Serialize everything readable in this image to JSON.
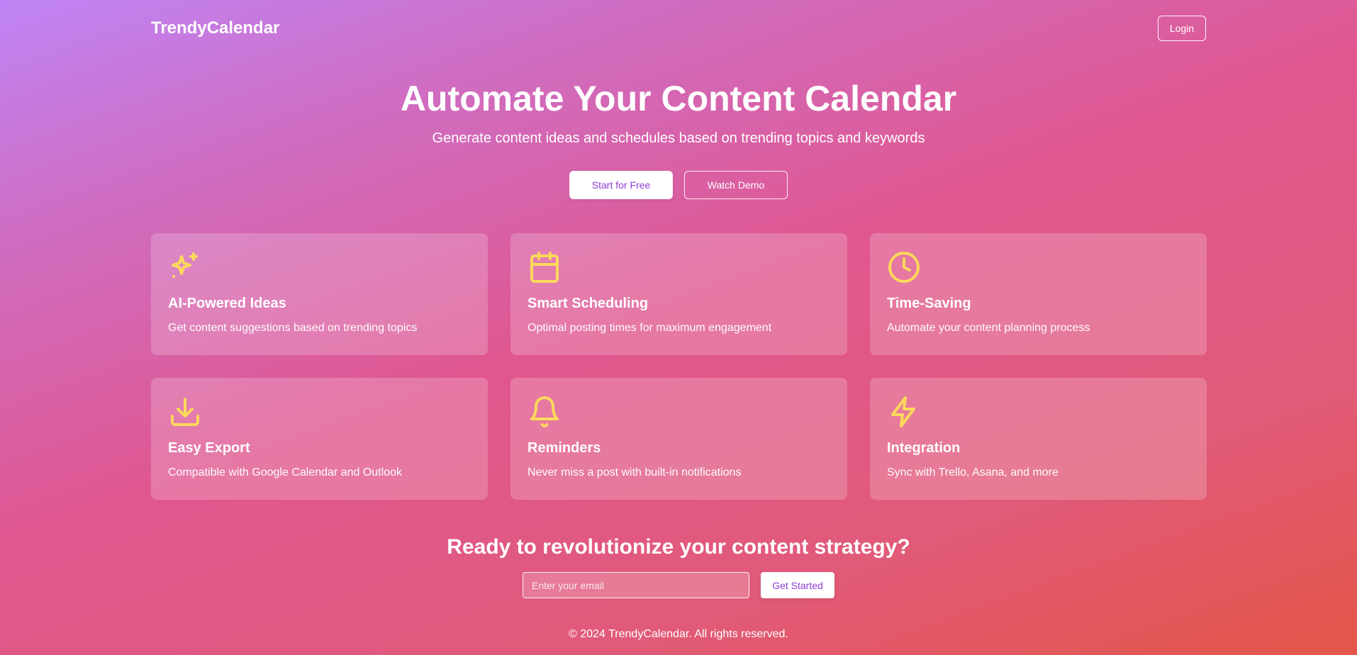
{
  "header": {
    "logo": "TrendyCalendar",
    "login_label": "Login"
  },
  "hero": {
    "title": "Automate Your Content Calendar",
    "subtitle": "Generate content ideas and schedules based on trending topics and keywords",
    "primary_label": "Start for Free",
    "secondary_label": "Watch Demo"
  },
  "features": [
    {
      "icon": "sparkles-icon",
      "title": "AI-Powered Ideas",
      "description": "Get content suggestions based on trending topics"
    },
    {
      "icon": "calendar-icon",
      "title": "Smart Scheduling",
      "description": "Optimal posting times for maximum engagement"
    },
    {
      "icon": "clock-icon",
      "title": "Time-Saving",
      "description": "Automate your content planning process"
    },
    {
      "icon": "download-icon",
      "title": "Easy Export",
      "description": "Compatible with Google Calendar and Outlook"
    },
    {
      "icon": "bell-icon",
      "title": "Reminders",
      "description": "Never miss a post with built-in notifications"
    },
    {
      "icon": "lightning-icon",
      "title": "Integration",
      "description": "Sync with Trello, Asana, and more"
    }
  ],
  "cta": {
    "title": "Ready to revolutionize your content strategy?",
    "email_placeholder": "Enter your email",
    "email_value": "",
    "button_label": "Get Started"
  },
  "footer": {
    "text": "© 2024 TrendyCalendar. All rights reserved."
  },
  "colors": {
    "icon": "#fcd95a",
    "accent": "#8d3cd6",
    "gradient_start": "#bf84f6",
    "gradient_end": "#e35648"
  }
}
